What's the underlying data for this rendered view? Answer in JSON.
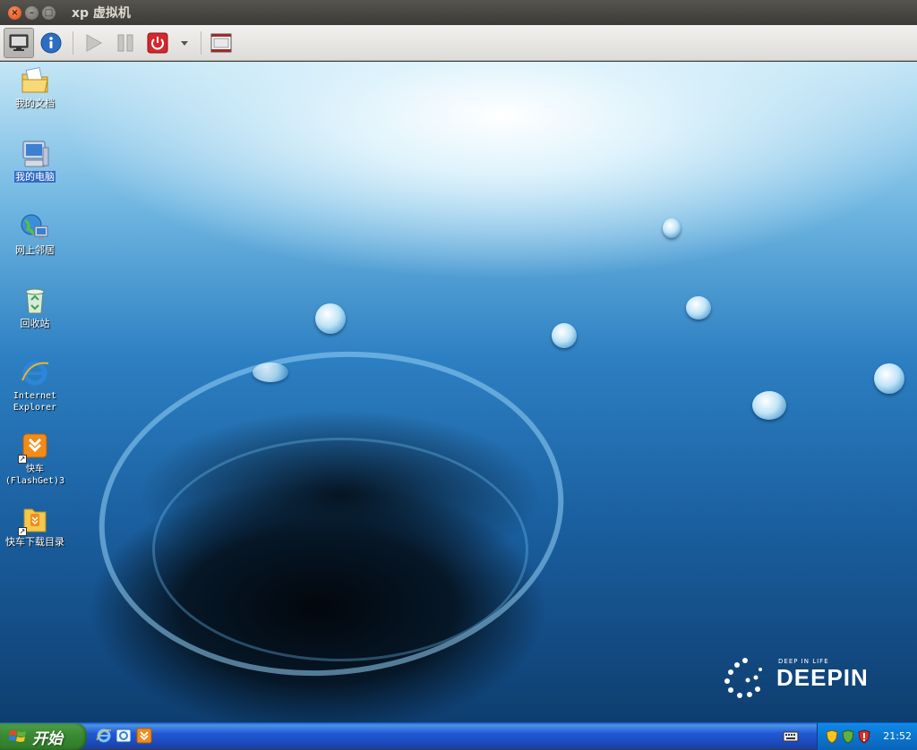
{
  "window": {
    "title": "xp 虚拟机",
    "close_glyph": "×",
    "minimize_glyph": "–",
    "maximize_glyph": "□"
  },
  "toolbar": {
    "buttons": [
      {
        "name": "display",
        "icon": "monitor-icon",
        "active": true
      },
      {
        "name": "info",
        "icon": "info-icon"
      },
      {
        "name": "play",
        "icon": "play-icon"
      },
      {
        "name": "pause",
        "icon": "pause-icon"
      },
      {
        "name": "power",
        "icon": "power-icon"
      },
      {
        "name": "power-menu",
        "icon": "dropdown-arrow-icon"
      },
      {
        "name": "fullscreen",
        "icon": "fullscreen-icon"
      }
    ]
  },
  "desktop": {
    "icons": [
      {
        "label": "我的文档",
        "icon": "my-documents-icon"
      },
      {
        "label": "我的电脑",
        "icon": "my-computer-icon",
        "selected": true
      },
      {
        "label": "网上邻居",
        "icon": "network-places-icon"
      },
      {
        "label": "回收站",
        "icon": "recycle-bin-icon"
      },
      {
        "label": "Internet\nExplorer",
        "icon": "internet-explorer-icon"
      },
      {
        "label": "快车\n(FlashGet)3",
        "icon": "flashget-icon",
        "shortcut": true
      },
      {
        "label": "快车下载目录",
        "icon": "download-folder-icon",
        "shortcut": true
      }
    ],
    "wallpaper_brand": {
      "tagline": "DEEP IN LIFE",
      "name": "DEEPIN"
    }
  },
  "taskbar": {
    "start_label": "开始",
    "quick_launch": [
      {
        "icon": "internet-explorer-icon"
      },
      {
        "icon": "outlook-express-icon"
      },
      {
        "icon": "flashget-icon"
      }
    ],
    "tray": {
      "keyboard_icon": "keyboard-icon",
      "icons": [
        "security-shield-icon",
        "network-shield-icon",
        "alert-shield-icon"
      ],
      "clock": "21:52"
    }
  },
  "colors": {
    "taskbar_blue": "#245edb",
    "start_green": "#3a8a34",
    "selection_blue": "#316ac5"
  }
}
